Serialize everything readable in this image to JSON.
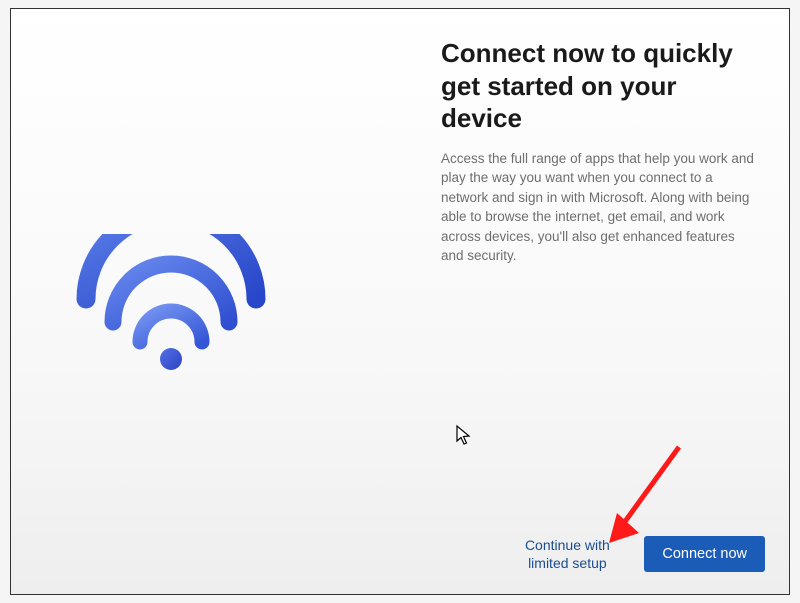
{
  "dialog": {
    "headline": "Connect now to quickly get started on your device",
    "description": "Access the full range of apps that help you work and play the way you want when you connect to a network and sign in with Microsoft. Along with being able to browse the internet, get email, and work across devices, you'll also get enhanced features and security."
  },
  "buttons": {
    "secondary": "Continue with limited setup",
    "primary": "Connect now"
  },
  "icons": {
    "wifi": "wifi-icon",
    "cursor": "mouse-cursor-icon",
    "arrow": "annotation-arrow-icon"
  },
  "colors": {
    "primary_button": "#1a5cb8",
    "link": "#1a4d8f",
    "wifi_gradient_start": "#5a7de8",
    "wifi_gradient_end": "#2846c9",
    "annotation_arrow": "#ff1a1a"
  }
}
